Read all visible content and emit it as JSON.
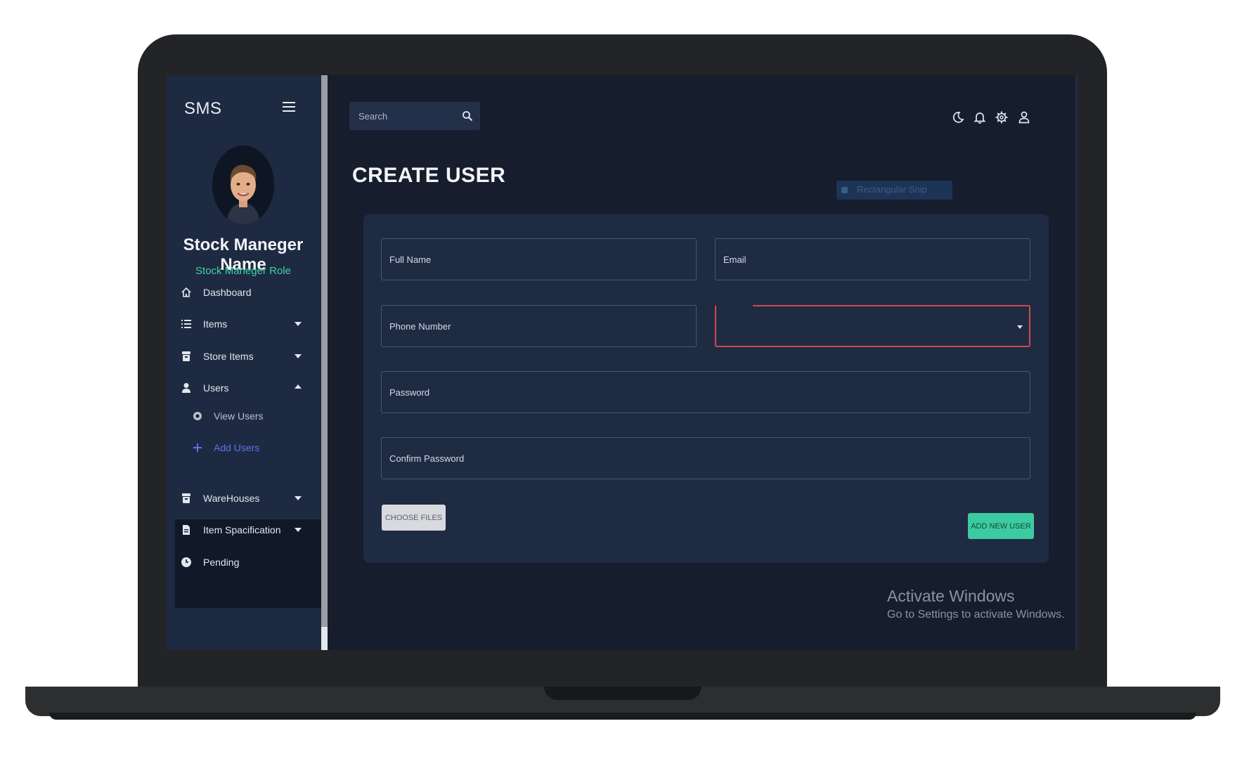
{
  "app": {
    "brand": "SMS"
  },
  "profile": {
    "name": "Stock Maneger Name",
    "role": "Stock Maneger Role"
  },
  "sidebar": {
    "items": [
      {
        "label": "Dashboard",
        "icon": "home-icon"
      },
      {
        "label": "Items",
        "icon": "list-icon"
      },
      {
        "label": "Store Items",
        "icon": "store-icon"
      },
      {
        "label": "Users",
        "icon": "user-icon"
      },
      {
        "label": "WareHouses",
        "icon": "warehouse-icon"
      },
      {
        "label": "Item Spacification",
        "icon": "document-icon"
      },
      {
        "label": "Pending",
        "icon": "clock-icon"
      }
    ],
    "users_submenu": [
      {
        "label": "View Users",
        "icon": "eye-icon"
      },
      {
        "label": "Add Users",
        "icon": "plus-icon"
      }
    ]
  },
  "topbar": {
    "search_placeholder": "Search",
    "icons": [
      "moon-icon",
      "bell-icon",
      "gear-icon",
      "account-icon"
    ]
  },
  "page": {
    "title": "CREATE USER"
  },
  "form": {
    "full_name_placeholder": "Full Name",
    "email_placeholder": "Email",
    "phone_placeholder": "Phone Number",
    "role_select_value": "",
    "password_placeholder": "Password",
    "confirm_password_placeholder": "Confirm Password",
    "choose_files_label": "CHOOSE FILES",
    "submit_label": "ADD NEW USER"
  },
  "overlay": {
    "snip_label": "Rectangular Snip",
    "activate_title": "Activate Windows",
    "activate_subtitle": "Go to Settings to activate Windows."
  },
  "colors": {
    "background": "#161d2d",
    "sidebar": "#1e2a41",
    "card": "#1f2b43",
    "accent_green": "#3ccba0",
    "accent_blue": "#5d72f0",
    "error_red": "#d04a4f"
  }
}
